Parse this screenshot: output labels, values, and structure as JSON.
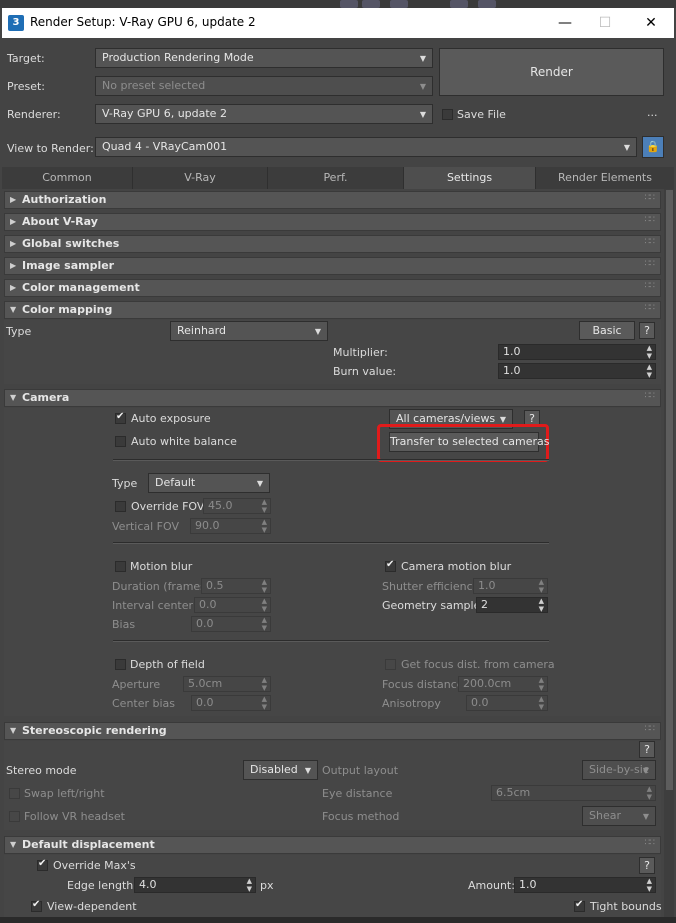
{
  "window": {
    "title": "Render Setup: V-Ray GPU 6, update 2",
    "app_icon": "3",
    "minimize": "—",
    "maximize": "☐",
    "close": "✕"
  },
  "header": {
    "target_label": "Target:",
    "target_value": "Production Rendering Mode",
    "preset_label": "Preset:",
    "preset_value": "No preset selected",
    "renderer_label": "Renderer:",
    "renderer_value": "V-Ray GPU 6, update 2",
    "render_button": "Render",
    "save_file_label": "Save File",
    "more_button": "...",
    "view_label": "View to Render:",
    "view_value": "Quad 4 - VRayCam001"
  },
  "tabs": [
    {
      "label": "Common"
    },
    {
      "label": "V-Ray"
    },
    {
      "label": "Perf."
    },
    {
      "label": "Settings"
    },
    {
      "label": "Render Elements"
    }
  ],
  "rollouts": {
    "authorization": "Authorization",
    "about": "About V-Ray",
    "global_switches": "Global switches",
    "image_sampler": "Image sampler",
    "color_management": "Color management",
    "color_mapping": "Color mapping",
    "camera": "Camera",
    "stereoscopic": "Stereoscopic rendering",
    "displacement": "Default displacement"
  },
  "color_mapping": {
    "type_label": "Type",
    "type_value": "Reinhard",
    "basic_button": "Basic",
    "help": "?",
    "multiplier_label": "Multiplier:",
    "multiplier_value": "1.0",
    "burn_label": "Burn value:",
    "burn_value": "1.0"
  },
  "camera": {
    "auto_exposure": "Auto exposure",
    "auto_white_balance": "Auto white balance",
    "cameras_dropdown": "All cameras/views",
    "help": "?",
    "transfer_button": "Transfer to selected cameras",
    "type_label": "Type",
    "type_value": "Default",
    "override_fov": "Override FOV",
    "override_fov_value": "45.0",
    "vertical_fov": "Vertical FOV",
    "vertical_fov_value": "90.0",
    "motion_blur": "Motion blur",
    "duration_label": "Duration (frames)",
    "duration_value": "0.5",
    "interval_label": "Interval center",
    "interval_value": "0.0",
    "bias_label": "Bias",
    "bias_value": "0.0",
    "camera_motion_blur": "Camera motion blur",
    "shutter_label": "Shutter efficiency",
    "shutter_value": "1.0",
    "geometry_label": "Geometry samples",
    "geometry_value": "2",
    "dof": "Depth of field",
    "aperture_label": "Aperture",
    "aperture_value": "5.0cm",
    "center_bias_label": "Center bias",
    "center_bias_value": "0.0",
    "get_focus": "Get focus dist. from camera",
    "focus_dist_label": "Focus distance",
    "focus_dist_value": "200.0cm",
    "anisotropy_label": "Anisotropy",
    "anisotropy_value": "0.0"
  },
  "stereo": {
    "help": "?",
    "mode_label": "Stereo mode",
    "mode_value": "Disabled",
    "output_layout_label": "Output layout",
    "output_layout_value": "Side-by-sic",
    "swap": "Swap left/right",
    "eye_label": "Eye distance",
    "eye_value": "6.5cm",
    "follow_vr": "Follow VR headset",
    "focus_method_label": "Focus method",
    "focus_method_value": "Shear"
  },
  "displacement": {
    "override": "Override Max's",
    "help": "?",
    "edge_label": "Edge length:",
    "edge_value": "4.0",
    "edge_unit": "px",
    "amount_label": "Amount:",
    "amount_value": "1.0",
    "view_dependent": "View-dependent",
    "tight_bounds": "Tight bounds"
  },
  "icons": {
    "grip": "∷∷",
    "expand": "▶",
    "collapse": "▼",
    "dropdown": "▼",
    "lock": "🔒"
  },
  "colors": {
    "highlight": "#e01b1b",
    "panel_bg": "#444444"
  }
}
